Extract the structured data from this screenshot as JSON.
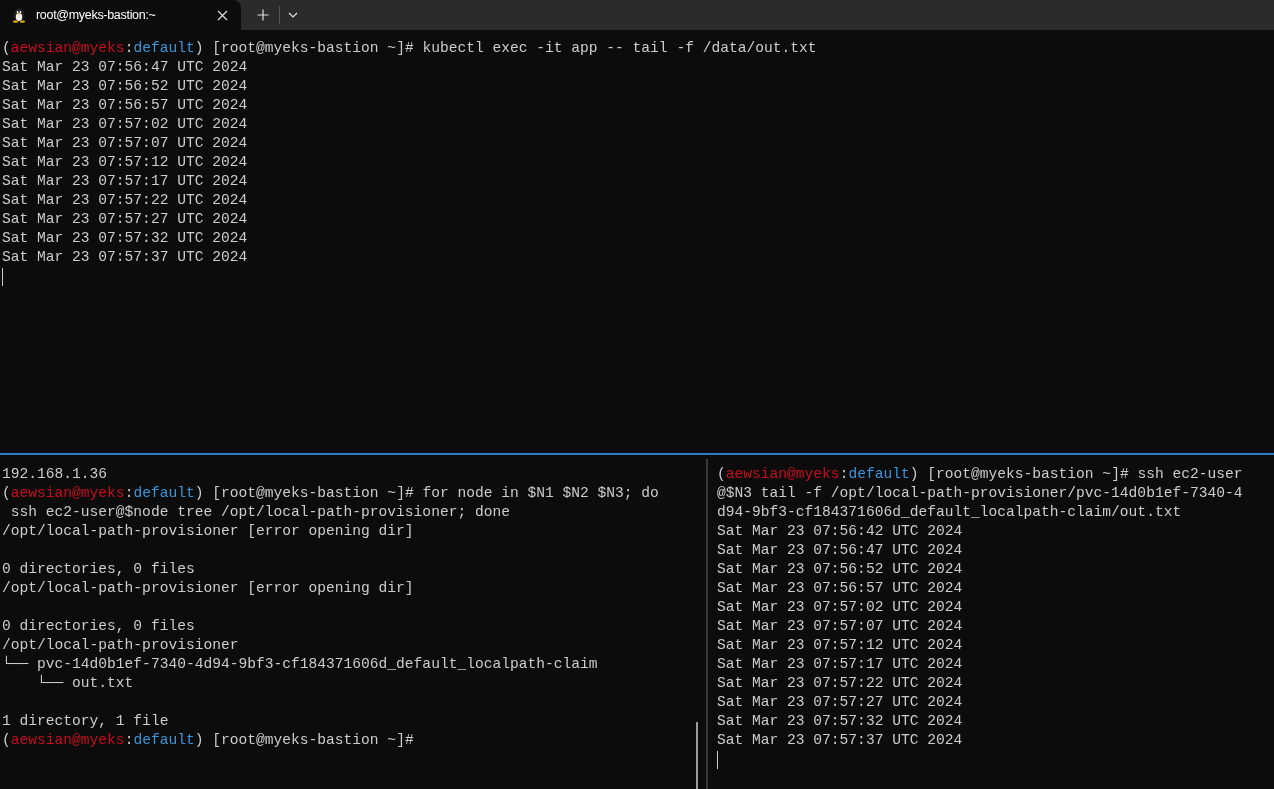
{
  "tab": {
    "title": "root@myeks-bastion:~",
    "selected": true
  },
  "top_pane": {
    "lines": [
      {
        "kind": "prompt",
        "open": "(",
        "user": "aewsian@myeks",
        "colon": ":",
        "context": "default",
        "text": ") [root@myeks-bastion ~]# kubectl exec -it app -- tail -f /data/out.txt"
      },
      {
        "kind": "text",
        "text": "Sat Mar 23 07:56:47 UTC 2024"
      },
      {
        "kind": "text",
        "text": "Sat Mar 23 07:56:52 UTC 2024"
      },
      {
        "kind": "text",
        "text": "Sat Mar 23 07:56:57 UTC 2024"
      },
      {
        "kind": "text",
        "text": "Sat Mar 23 07:57:02 UTC 2024"
      },
      {
        "kind": "text",
        "text": "Sat Mar 23 07:57:07 UTC 2024"
      },
      {
        "kind": "text",
        "text": "Sat Mar 23 07:57:12 UTC 2024"
      },
      {
        "kind": "text",
        "text": "Sat Mar 23 07:57:17 UTC 2024"
      },
      {
        "kind": "text",
        "text": "Sat Mar 23 07:57:22 UTC 2024"
      },
      {
        "kind": "text",
        "text": "Sat Mar 23 07:57:27 UTC 2024"
      },
      {
        "kind": "text",
        "text": "Sat Mar 23 07:57:32 UTC 2024"
      },
      {
        "kind": "text",
        "text": "Sat Mar 23 07:57:37 UTC 2024"
      },
      {
        "kind": "cursor"
      }
    ]
  },
  "bottom_left_pane": {
    "lines": [
      {
        "kind": "text",
        "text": "192.168.1.36"
      },
      {
        "kind": "prompt",
        "open": "(",
        "user": "aewsian@myeks",
        "colon": ":",
        "context": "default",
        "text": ") [root@myeks-bastion ~]# for node in $N1 $N2 $N3; do"
      },
      {
        "kind": "text",
        "text": " ssh ec2-user@$node tree /opt/local-path-provisioner; done"
      },
      {
        "kind": "text",
        "text": "/opt/local-path-provisioner [error opening dir]"
      },
      {
        "kind": "blank"
      },
      {
        "kind": "text",
        "text": "0 directories, 0 files"
      },
      {
        "kind": "text",
        "text": "/opt/local-path-provisioner [error opening dir]"
      },
      {
        "kind": "blank"
      },
      {
        "kind": "text",
        "text": "0 directories, 0 files"
      },
      {
        "kind": "text",
        "text": "/opt/local-path-provisioner"
      },
      {
        "kind": "text",
        "text": "└── pvc-14d0b1ef-7340-4d94-9bf3-cf184371606d_default_localpath-claim"
      },
      {
        "kind": "text",
        "text": "    └── out.txt"
      },
      {
        "kind": "blank"
      },
      {
        "kind": "text",
        "text": "1 directory, 1 file"
      },
      {
        "kind": "prompt",
        "open": "(",
        "user": "aewsian@myeks",
        "colon": ":",
        "context": "default",
        "text": ") [root@myeks-bastion ~]#"
      }
    ]
  },
  "bottom_right_pane": {
    "lines": [
      {
        "kind": "prompt",
        "open": "(",
        "user": "aewsian@myeks",
        "colon": ":",
        "context": "default",
        "text": ") [root@myeks-bastion ~]# ssh ec2-user"
      },
      {
        "kind": "text",
        "text": "@$N3 tail -f /opt/local-path-provisioner/pvc-14d0b1ef-7340-4"
      },
      {
        "kind": "text",
        "text": "d94-9bf3-cf184371606d_default_localpath-claim/out.txt"
      },
      {
        "kind": "text",
        "text": "Sat Mar 23 07:56:42 UTC 2024"
      },
      {
        "kind": "text",
        "text": "Sat Mar 23 07:56:47 UTC 2024"
      },
      {
        "kind": "text",
        "text": "Sat Mar 23 07:56:52 UTC 2024"
      },
      {
        "kind": "text",
        "text": "Sat Mar 23 07:56:57 UTC 2024"
      },
      {
        "kind": "text",
        "text": "Sat Mar 23 07:57:02 UTC 2024"
      },
      {
        "kind": "text",
        "text": "Sat Mar 23 07:57:07 UTC 2024"
      },
      {
        "kind": "text",
        "text": "Sat Mar 23 07:57:12 UTC 2024"
      },
      {
        "kind": "text",
        "text": "Sat Mar 23 07:57:17 UTC 2024"
      },
      {
        "kind": "text",
        "text": "Sat Mar 23 07:57:22 UTC 2024"
      },
      {
        "kind": "text",
        "text": "Sat Mar 23 07:57:27 UTC 2024"
      },
      {
        "kind": "text",
        "text": "Sat Mar 23 07:57:32 UTC 2024"
      },
      {
        "kind": "text",
        "text": "Sat Mar 23 07:57:37 UTC 2024"
      },
      {
        "kind": "cursor"
      }
    ]
  }
}
